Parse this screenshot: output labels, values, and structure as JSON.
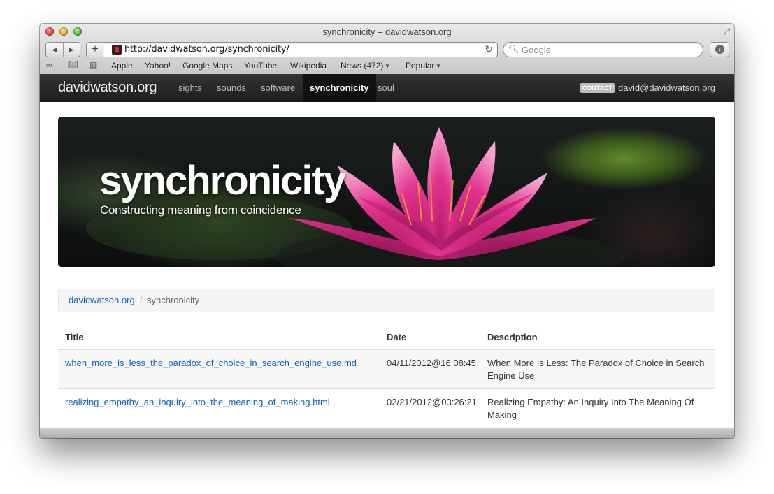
{
  "window": {
    "title": "synchronicity – davidwatson.org"
  },
  "toolbar": {
    "back_label": "◀",
    "forward_label": "▶",
    "add_label": "+",
    "url": "http://davidwatson.org/synchronicity/",
    "reload_icon": "↻",
    "search_placeholder": "Google",
    "search_icon": "🔍︎"
  },
  "bookmarks": {
    "reading_list_icon": "∞",
    "bookmarks_icon": "📖︎",
    "top_sites_icon": "▦",
    "items": [
      "Apple",
      "Yahoo!",
      "Google Maps",
      "YouTube",
      "Wikipedia",
      "News (472)",
      "Popular"
    ]
  },
  "site": {
    "brand": "davidwatson.org",
    "nav": [
      "sights",
      "sounds",
      "software",
      "synchronicity",
      "soul"
    ],
    "active_nav": "synchronicity",
    "contact_badge": "CONTACT",
    "contact_email": "david@davidwatson.org"
  },
  "hero": {
    "title": "synchronicity",
    "subtitle": "Constructing meaning from coincidence"
  },
  "breadcrumb": {
    "home": "davidwatson.org",
    "separator": "/",
    "current": "synchronicity"
  },
  "table": {
    "headers": [
      "Title",
      "Date",
      "Description"
    ],
    "rows": [
      {
        "title": "when_more_is_less_the_paradox_of_choice_in_search_engine_use.md",
        "date": "04/11/2012@16:08:45",
        "desc_line1": "When More Is Less: The Paradox of Choice in Search",
        "desc_line2": "Engine Use"
      },
      {
        "title": "realizing_empathy_an_inquiry_into_the_meaning_of_making.html",
        "date": "02/21/2012@03:26:21",
        "desc_line1": "Realizing Empathy: An Inquiry Into The Meaning Of",
        "desc_line2": "Making"
      }
    ]
  },
  "colors": {
    "link": "#0b62c1",
    "nav_bg": "#222222",
    "accent_flower": "#e0348f"
  }
}
